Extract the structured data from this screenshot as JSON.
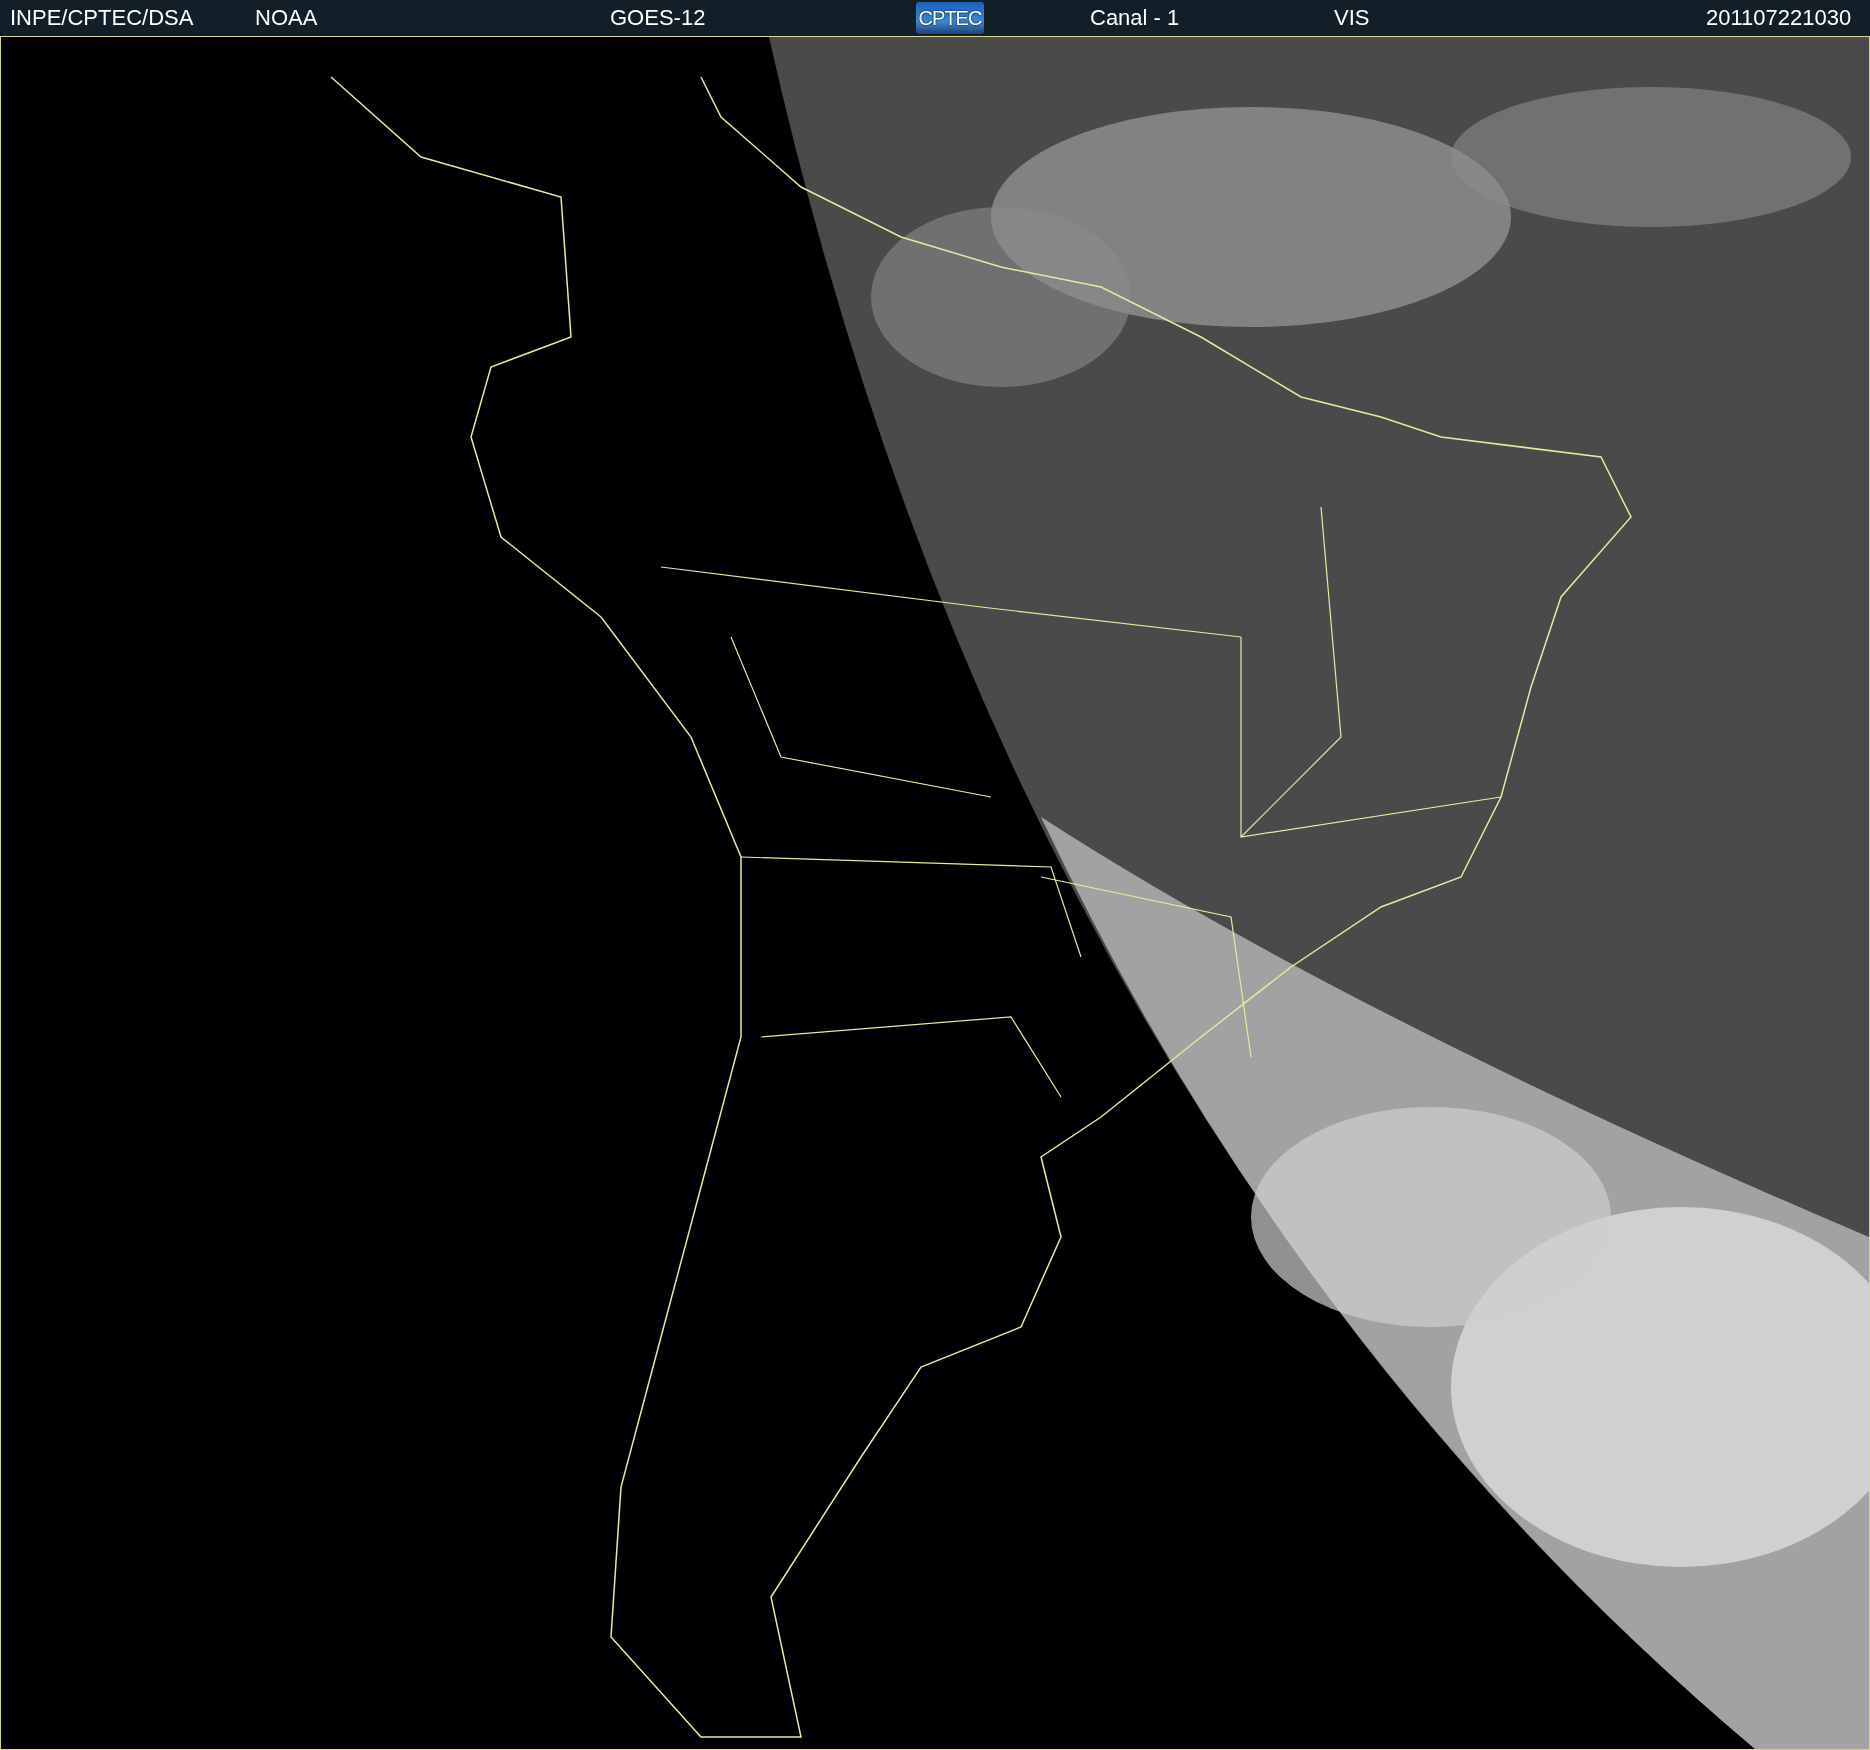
{
  "header": {
    "items": [
      {
        "kind": "text",
        "text": "INPE/CPTEC/DSA"
      },
      {
        "kind": "text",
        "text": "NOAA"
      },
      {
        "kind": "text",
        "text": "GOES-12"
      },
      {
        "kind": "logo",
        "text": "CPTEC"
      },
      {
        "kind": "text",
        "text": "Canal - 1"
      },
      {
        "kind": "text",
        "text": "VIS"
      },
      {
        "kind": "text",
        "text": "201107221030"
      }
    ]
  }
}
